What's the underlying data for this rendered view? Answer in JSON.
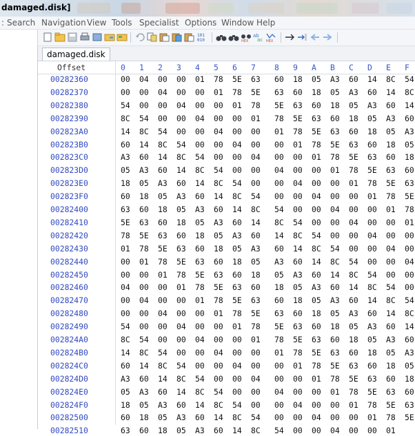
{
  "window": {
    "title": "damaged.disk]"
  },
  "menu": [
    "Search",
    "Navigation",
    "View",
    "Tools",
    "Specialist",
    "Options",
    "Window",
    "Help"
  ],
  "toolbar": {
    "buttons": [
      "new-file-icon",
      "open-folder-icon",
      "save-icon",
      "print-icon",
      "properties-icon",
      "open-drive-icon",
      "undo-icon",
      "copy-icon",
      "paste-icon",
      "cut-icon",
      "paste-hex-icon",
      "binary-icon",
      "find-icon",
      "find-next-icon",
      "find-hex-icon",
      "replace-icon",
      "replace-hex-icon",
      "goto-icon",
      "goto-offset-icon",
      "back-arrow-icon",
      "forward-arrow-icon"
    ]
  },
  "tab": {
    "label": "damaged.disk"
  },
  "hex_header": {
    "offset_label": "Offset",
    "columns": [
      "0",
      "1",
      "2",
      "3",
      "4",
      "5",
      "6",
      "7",
      "8",
      "9",
      "A",
      "B",
      "C",
      "D",
      "E",
      "F"
    ]
  },
  "rows": [
    {
      "offset": "00282360",
      "bytes": [
        "00",
        "04",
        "00",
        "00",
        "01",
        "78",
        "5E",
        "63",
        "60",
        "18",
        "05",
        "A3",
        "60",
        "14",
        "8C",
        "54"
      ]
    },
    {
      "offset": "00282370",
      "bytes": [
        "00",
        "00",
        "04",
        "00",
        "00",
        "01",
        "78",
        "5E",
        "63",
        "60",
        "18",
        "05",
        "A3",
        "60",
        "14",
        "8C"
      ]
    },
    {
      "offset": "00282380",
      "bytes": [
        "54",
        "00",
        "00",
        "04",
        "00",
        "00",
        "01",
        "78",
        "5E",
        "63",
        "60",
        "18",
        "05",
        "A3",
        "60",
        "14"
      ]
    },
    {
      "offset": "00282390",
      "bytes": [
        "8C",
        "54",
        "00",
        "00",
        "04",
        "00",
        "00",
        "01",
        "78",
        "5E",
        "63",
        "60",
        "18",
        "05",
        "A3",
        "60"
      ]
    },
    {
      "offset": "002823A0",
      "bytes": [
        "14",
        "8C",
        "54",
        "00",
        "00",
        "04",
        "00",
        "00",
        "01",
        "78",
        "5E",
        "63",
        "60",
        "18",
        "05",
        "A3"
      ]
    },
    {
      "offset": "002823B0",
      "bytes": [
        "60",
        "14",
        "8C",
        "54",
        "00",
        "00",
        "04",
        "00",
        "00",
        "01",
        "78",
        "5E",
        "63",
        "60",
        "18",
        "05"
      ]
    },
    {
      "offset": "002823C0",
      "bytes": [
        "A3",
        "60",
        "14",
        "8C",
        "54",
        "00",
        "00",
        "04",
        "00",
        "00",
        "01",
        "78",
        "5E",
        "63",
        "60",
        "18"
      ]
    },
    {
      "offset": "002823D0",
      "bytes": [
        "05",
        "A3",
        "60",
        "14",
        "8C",
        "54",
        "00",
        "00",
        "04",
        "00",
        "00",
        "01",
        "78",
        "5E",
        "63",
        "60"
      ]
    },
    {
      "offset": "002823E0",
      "bytes": [
        "18",
        "05",
        "A3",
        "60",
        "14",
        "8C",
        "54",
        "00",
        "00",
        "04",
        "00",
        "00",
        "01",
        "78",
        "5E",
        "63"
      ]
    },
    {
      "offset": "002823F0",
      "bytes": [
        "60",
        "18",
        "05",
        "A3",
        "60",
        "14",
        "8C",
        "54",
        "00",
        "00",
        "04",
        "00",
        "00",
        "01",
        "78",
        "5E"
      ]
    },
    {
      "offset": "00282400",
      "bytes": [
        "63",
        "60",
        "18",
        "05",
        "A3",
        "60",
        "14",
        "8C",
        "54",
        "00",
        "00",
        "04",
        "00",
        "00",
        "01",
        "78"
      ]
    },
    {
      "offset": "00282410",
      "bytes": [
        "5E",
        "63",
        "60",
        "18",
        "05",
        "A3",
        "60",
        "14",
        "8C",
        "54",
        "00",
        "00",
        "04",
        "00",
        "00",
        "01"
      ]
    },
    {
      "offset": "00282420",
      "bytes": [
        "78",
        "5E",
        "63",
        "60",
        "18",
        "05",
        "A3",
        "60",
        "14",
        "8C",
        "54",
        "00",
        "00",
        "04",
        "00",
        "00"
      ]
    },
    {
      "offset": "00282430",
      "bytes": [
        "01",
        "78",
        "5E",
        "63",
        "60",
        "18",
        "05",
        "A3",
        "60",
        "14",
        "8C",
        "54",
        "00",
        "00",
        "04",
        "00"
      ]
    },
    {
      "offset": "00282440",
      "bytes": [
        "00",
        "01",
        "78",
        "5E",
        "63",
        "60",
        "18",
        "05",
        "A3",
        "60",
        "14",
        "8C",
        "54",
        "00",
        "00",
        "04"
      ]
    },
    {
      "offset": "00282450",
      "bytes": [
        "00",
        "00",
        "01",
        "78",
        "5E",
        "63",
        "60",
        "18",
        "05",
        "A3",
        "60",
        "14",
        "8C",
        "54",
        "00",
        "00"
      ]
    },
    {
      "offset": "00282460",
      "bytes": [
        "04",
        "00",
        "00",
        "01",
        "78",
        "5E",
        "63",
        "60",
        "18",
        "05",
        "A3",
        "60",
        "14",
        "8C",
        "54",
        "00"
      ]
    },
    {
      "offset": "00282470",
      "bytes": [
        "00",
        "04",
        "00",
        "00",
        "01",
        "78",
        "5E",
        "63",
        "60",
        "18",
        "05",
        "A3",
        "60",
        "14",
        "8C",
        "54"
      ]
    },
    {
      "offset": "00282480",
      "bytes": [
        "00",
        "00",
        "04",
        "00",
        "00",
        "01",
        "78",
        "5E",
        "63",
        "60",
        "18",
        "05",
        "A3",
        "60",
        "14",
        "8C"
      ]
    },
    {
      "offset": "00282490",
      "bytes": [
        "54",
        "00",
        "00",
        "04",
        "00",
        "00",
        "01",
        "78",
        "5E",
        "63",
        "60",
        "18",
        "05",
        "A3",
        "60",
        "14"
      ]
    },
    {
      "offset": "002824A0",
      "bytes": [
        "8C",
        "54",
        "00",
        "00",
        "04",
        "00",
        "00",
        "01",
        "78",
        "5E",
        "63",
        "60",
        "18",
        "05",
        "A3",
        "60"
      ]
    },
    {
      "offset": "002824B0",
      "bytes": [
        "14",
        "8C",
        "54",
        "00",
        "00",
        "04",
        "00",
        "00",
        "01",
        "78",
        "5E",
        "63",
        "60",
        "18",
        "05",
        "A3"
      ]
    },
    {
      "offset": "002824C0",
      "bytes": [
        "60",
        "14",
        "8C",
        "54",
        "00",
        "00",
        "04",
        "00",
        "00",
        "01",
        "78",
        "5E",
        "63",
        "60",
        "18",
        "05"
      ]
    },
    {
      "offset": "002824D0",
      "bytes": [
        "A3",
        "60",
        "14",
        "8C",
        "54",
        "00",
        "00",
        "04",
        "00",
        "00",
        "01",
        "78",
        "5E",
        "63",
        "60",
        "18"
      ]
    },
    {
      "offset": "002824E0",
      "bytes": [
        "05",
        "A3",
        "60",
        "14",
        "8C",
        "54",
        "00",
        "00",
        "04",
        "00",
        "00",
        "01",
        "78",
        "5E",
        "63",
        "60"
      ]
    },
    {
      "offset": "002824F0",
      "bytes": [
        "18",
        "05",
        "A3",
        "60",
        "14",
        "8C",
        "54",
        "00",
        "00",
        "04",
        "00",
        "00",
        "01",
        "78",
        "5E",
        "63"
      ]
    },
    {
      "offset": "00282500",
      "bytes": [
        "60",
        "18",
        "05",
        "A3",
        "60",
        "14",
        "8C",
        "54",
        "00",
        "00",
        "04",
        "00",
        "00",
        "01",
        "78",
        "5E"
      ]
    },
    {
      "offset": "00282510",
      "bytes": [
        "63",
        "60",
        "18",
        "05",
        "A3",
        "60",
        "14",
        "8C",
        "54",
        "00",
        "00",
        "04",
        "00",
        "00",
        "01",
        ""
      ]
    }
  ]
}
